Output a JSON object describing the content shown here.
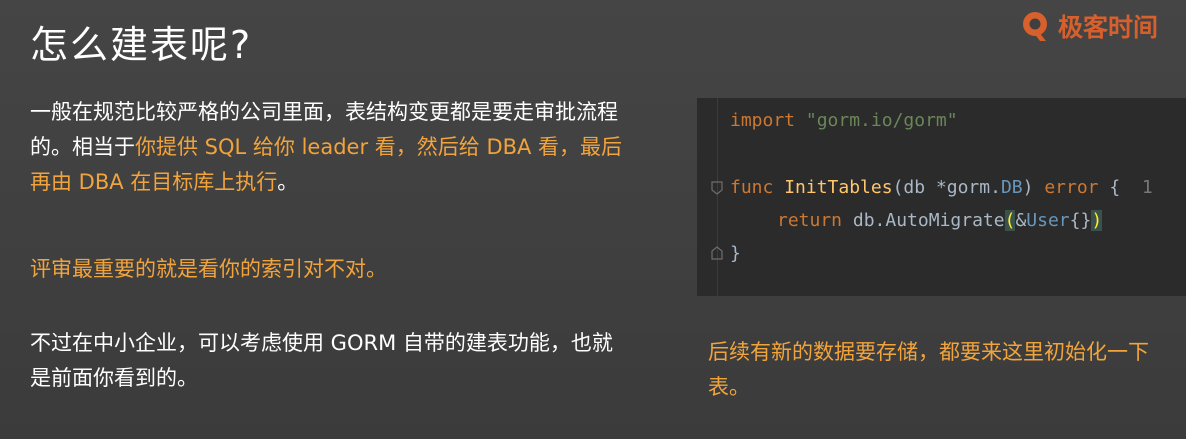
{
  "slide": {
    "title": "怎么建表呢?",
    "logo_text": "极客时间",
    "paragraph1": {
      "part1": "一般在规范比较严格的公司里面，表结构变更都是要走审批流程的。相当于",
      "part2": "你提供 SQL 给你 leader 看，然后给 DBA 看，最后再由 DBA 在目标库上执行",
      "part3": "。"
    },
    "paragraph2": "评审最重要的就是看你的索引对不对。",
    "paragraph3": "不过在中小企业，可以考虑使用 GORM 自带的建表功能，也就是前面你看到的。",
    "side_note": "后续有新的数据要存储，都要来这里初始化一下表。"
  },
  "code": {
    "line1_kw": "import",
    "line1_str": "\"gorm.io/gorm\"",
    "line2_kw": "func",
    "line2_fn": "InitTables",
    "line2_p1": "(db *gorm.",
    "line2_type": "DB",
    "line2_p2": ")",
    "line2_ret": "error",
    "line2_brace": "{",
    "line2_hint": "1",
    "line3_kw": "return",
    "line3_call": "db.AutoMigrate",
    "line3_open": "(",
    "line3_amp": "&",
    "line3_type": "User",
    "line3_braces": "{}",
    "line3_close": ")",
    "line4_brace": "}"
  },
  "colors": {
    "accent_orange": "#f2a43c",
    "logo_orange": "#e8632a",
    "code_bg": "#2b2b2b"
  }
}
